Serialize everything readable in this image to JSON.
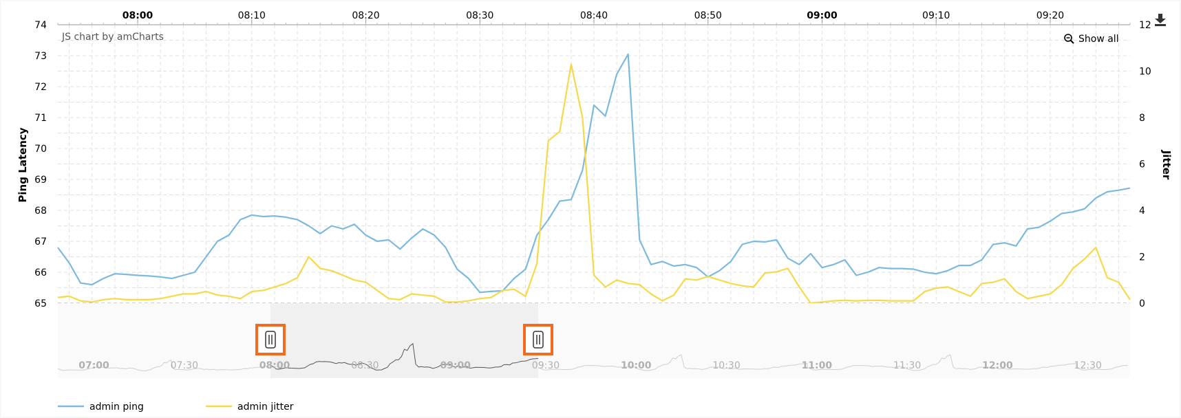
{
  "colors": {
    "ping": "#7db9dd",
    "jitter": "#f6d94a",
    "handle_border": "#f26b21",
    "scroll_selection": "#f0f0f0",
    "grid": "#e0e0e0"
  },
  "credit": "JS chart by amCharts",
  "show_all": "Show all",
  "icons": {
    "download": "download-icon",
    "zoom": "zoom-out-icon",
    "handle": "grip-handle-icon"
  },
  "chart_data": {
    "type": "line",
    "x_unit": "time (HH:MM)",
    "x_range": [
      "07:53",
      "09:27"
    ],
    "x_ticks": [
      {
        "label": "08:00",
        "bold": true
      },
      {
        "label": "08:10",
        "bold": false
      },
      {
        "label": "08:20",
        "bold": false
      },
      {
        "label": "08:30",
        "bold": false
      },
      {
        "label": "08:40",
        "bold": false
      },
      {
        "label": "08:50",
        "bold": false
      },
      {
        "label": "09:00",
        "bold": true
      },
      {
        "label": "09:10",
        "bold": false
      },
      {
        "label": "09:20",
        "bold": false
      }
    ],
    "y_left": {
      "label": "Ping Latency",
      "range": [
        65,
        74
      ],
      "ticks": [
        "65",
        "66",
        "67",
        "68",
        "69",
        "70",
        "71",
        "72",
        "73",
        "74"
      ]
    },
    "y_right": {
      "label": "Jitter",
      "range": [
        0,
        12
      ],
      "ticks": [
        "0",
        "2",
        "4",
        "6",
        "8",
        "10",
        "12"
      ]
    },
    "grid": true,
    "legend_position": "bottom-left",
    "series": [
      {
        "name": "admin ping",
        "axis": "left",
        "points": [
          [
            "07:53",
            66.8
          ],
          [
            "07:54",
            66.3
          ],
          [
            "07:55",
            65.65
          ],
          [
            "07:56",
            65.6
          ],
          [
            "07:57",
            65.8
          ],
          [
            "07:58",
            65.95
          ],
          [
            "07:59",
            65.93
          ],
          [
            "08:00",
            65.9
          ],
          [
            "08:01",
            65.88
          ],
          [
            "08:02",
            65.85
          ],
          [
            "08:03",
            65.8
          ],
          [
            "08:04",
            65.9
          ],
          [
            "08:05",
            66.0
          ],
          [
            "08:06",
            66.5
          ],
          [
            "08:07",
            67.0
          ],
          [
            "08:08",
            67.2
          ],
          [
            "08:09",
            67.7
          ],
          [
            "08:10",
            67.85
          ],
          [
            "08:11",
            67.8
          ],
          [
            "08:12",
            67.82
          ],
          [
            "08:13",
            67.78
          ],
          [
            "08:14",
            67.7
          ],
          [
            "08:15",
            67.5
          ],
          [
            "08:16",
            67.25
          ],
          [
            "08:17",
            67.5
          ],
          [
            "08:18",
            67.4
          ],
          [
            "08:19",
            67.55
          ],
          [
            "08:20",
            67.2
          ],
          [
            "08:21",
            67.0
          ],
          [
            "08:22",
            67.05
          ],
          [
            "08:23",
            66.75
          ],
          [
            "08:24",
            67.1
          ],
          [
            "08:25",
            67.4
          ],
          [
            "08:26",
            67.2
          ],
          [
            "08:27",
            66.8
          ],
          [
            "08:28",
            66.1
          ],
          [
            "08:29",
            65.8
          ],
          [
            "08:30",
            65.35
          ],
          [
            "08:31",
            65.38
          ],
          [
            "08:32",
            65.4
          ],
          [
            "08:33",
            65.8
          ],
          [
            "08:34",
            66.1
          ],
          [
            "08:35",
            67.2
          ],
          [
            "08:36",
            67.7
          ],
          [
            "08:37",
            68.3
          ],
          [
            "08:38",
            68.35
          ],
          [
            "08:39",
            69.3
          ],
          [
            "08:40",
            71.4
          ],
          [
            "08:41",
            71.05
          ],
          [
            "08:42",
            72.4
          ],
          [
            "08:43",
            73.05
          ],
          [
            "08:44",
            67.05
          ],
          [
            "08:45",
            66.25
          ],
          [
            "08:46",
            66.35
          ],
          [
            "08:47",
            66.2
          ],
          [
            "08:48",
            66.25
          ],
          [
            "08:49",
            66.15
          ],
          [
            "08:50",
            65.85
          ],
          [
            "08:51",
            66.05
          ],
          [
            "08:52",
            66.35
          ],
          [
            "08:53",
            66.9
          ],
          [
            "08:54",
            67.0
          ],
          [
            "08:55",
            66.98
          ],
          [
            "08:56",
            67.05
          ],
          [
            "08:57",
            66.45
          ],
          [
            "08:58",
            66.25
          ],
          [
            "08:59",
            66.6
          ],
          [
            "09:00",
            66.15
          ],
          [
            "09:01",
            66.25
          ],
          [
            "09:02",
            66.4
          ],
          [
            "09:03",
            65.9
          ],
          [
            "09:04",
            66.0
          ],
          [
            "09:05",
            66.15
          ],
          [
            "09:06",
            66.12
          ],
          [
            "09:07",
            66.12
          ],
          [
            "09:08",
            66.1
          ],
          [
            "09:09",
            66.0
          ],
          [
            "09:10",
            65.95
          ],
          [
            "09:11",
            66.05
          ],
          [
            "09:12",
            66.22
          ],
          [
            "09:13",
            66.22
          ],
          [
            "09:14",
            66.4
          ],
          [
            "09:15",
            66.9
          ],
          [
            "09:16",
            66.95
          ],
          [
            "09:17",
            66.85
          ],
          [
            "09:18",
            67.4
          ],
          [
            "09:19",
            67.45
          ],
          [
            "09:20",
            67.65
          ],
          [
            "09:21",
            67.9
          ],
          [
            "09:22",
            67.95
          ],
          [
            "09:23",
            68.05
          ],
          [
            "09:24",
            68.4
          ],
          [
            "09:25",
            68.6
          ],
          [
            "09:26",
            68.65
          ],
          [
            "09:27",
            68.72
          ]
        ]
      },
      {
        "name": "admin jitter",
        "axis": "right",
        "points": [
          [
            "07:53",
            0.25
          ],
          [
            "07:54",
            0.3
          ],
          [
            "07:55",
            0.1
          ],
          [
            "07:56",
            0.05
          ],
          [
            "07:57",
            0.15
          ],
          [
            "07:58",
            0.2
          ],
          [
            "07:59",
            0.15
          ],
          [
            "08:00",
            0.15
          ],
          [
            "08:01",
            0.15
          ],
          [
            "08:02",
            0.2
          ],
          [
            "08:03",
            0.3
          ],
          [
            "08:04",
            0.4
          ],
          [
            "08:05",
            0.4
          ],
          [
            "08:06",
            0.5
          ],
          [
            "08:07",
            0.35
          ],
          [
            "08:08",
            0.3
          ],
          [
            "08:09",
            0.2
          ],
          [
            "08:10",
            0.5
          ],
          [
            "08:11",
            0.55
          ],
          [
            "08:12",
            0.7
          ],
          [
            "08:13",
            0.85
          ],
          [
            "08:14",
            1.1
          ],
          [
            "08:15",
            2.0
          ],
          [
            "08:16",
            1.5
          ],
          [
            "08:17",
            1.4
          ],
          [
            "08:18",
            1.2
          ],
          [
            "08:19",
            1.0
          ],
          [
            "08:20",
            0.9
          ],
          [
            "08:21",
            0.55
          ],
          [
            "08:22",
            0.2
          ],
          [
            "08:23",
            0.15
          ],
          [
            "08:24",
            0.4
          ],
          [
            "08:25",
            0.35
          ],
          [
            "08:26",
            0.3
          ],
          [
            "08:27",
            0.05
          ],
          [
            "08:28",
            0.05
          ],
          [
            "08:29",
            0.1
          ],
          [
            "08:30",
            0.2
          ],
          [
            "08:31",
            0.25
          ],
          [
            "08:32",
            0.55
          ],
          [
            "08:33",
            0.6
          ],
          [
            "08:34",
            0.3
          ],
          [
            "08:35",
            1.7
          ],
          [
            "08:36",
            7.0
          ],
          [
            "08:37",
            7.4
          ],
          [
            "08:38",
            10.3
          ],
          [
            "08:39",
            8.0
          ],
          [
            "08:40",
            1.2
          ],
          [
            "08:41",
            0.7
          ],
          [
            "08:42",
            1.0
          ],
          [
            "08:43",
            0.85
          ],
          [
            "08:44",
            0.8
          ],
          [
            "08:45",
            0.4
          ],
          [
            "08:46",
            0.1
          ],
          [
            "08:47",
            0.35
          ],
          [
            "08:48",
            1.05
          ],
          [
            "08:49",
            1.0
          ],
          [
            "08:50",
            1.15
          ],
          [
            "08:51",
            1.0
          ],
          [
            "08:52",
            0.85
          ],
          [
            "08:53",
            0.75
          ],
          [
            "08:54",
            0.7
          ],
          [
            "08:55",
            1.3
          ],
          [
            "08:56",
            1.35
          ],
          [
            "08:57",
            1.5
          ],
          [
            "08:58",
            0.7
          ],
          [
            "08:59",
            0.0
          ],
          [
            "09:00",
            0.05
          ],
          [
            "09:01",
            0.1
          ],
          [
            "09:02",
            0.12
          ],
          [
            "09:03",
            0.1
          ],
          [
            "09:04",
            0.12
          ],
          [
            "09:05",
            0.12
          ],
          [
            "09:06",
            0.1
          ],
          [
            "09:07",
            0.1
          ],
          [
            "09:08",
            0.1
          ],
          [
            "09:09",
            0.5
          ],
          [
            "09:10",
            0.65
          ],
          [
            "09:11",
            0.7
          ],
          [
            "09:12",
            0.5
          ],
          [
            "09:13",
            0.3
          ],
          [
            "09:14",
            0.85
          ],
          [
            "09:15",
            0.9
          ],
          [
            "09:16",
            1.05
          ],
          [
            "09:17",
            0.5
          ],
          [
            "09:18",
            0.2
          ],
          [
            "09:19",
            0.3
          ],
          [
            "09:20",
            0.4
          ],
          [
            "09:21",
            0.8
          ],
          [
            "09:22",
            1.5
          ],
          [
            "09:23",
            1.9
          ],
          [
            "09:24",
            2.4
          ],
          [
            "09:25",
            1.1
          ],
          [
            "09:26",
            0.9
          ],
          [
            "09:27",
            0.15
          ]
        ]
      }
    ],
    "scrollbar": {
      "labels": [
        {
          "label": "07:00",
          "bold": true
        },
        {
          "label": "07:30",
          "bold": false
        },
        {
          "label": "08:00",
          "bold": true
        },
        {
          "label": "08:30",
          "bold": false
        },
        {
          "label": "09:00",
          "bold": true
        },
        {
          "label": "09:30",
          "bold": false
        },
        {
          "label": "10:00",
          "bold": true
        },
        {
          "label": "10:30",
          "bold": false
        },
        {
          "label": "11:00",
          "bold": true
        },
        {
          "label": "11:30",
          "bold": false
        },
        {
          "label": "12:00",
          "bold": true
        },
        {
          "label": "12:30",
          "bold": false
        }
      ],
      "selection": [
        "07:53",
        "09:27"
      ]
    }
  }
}
